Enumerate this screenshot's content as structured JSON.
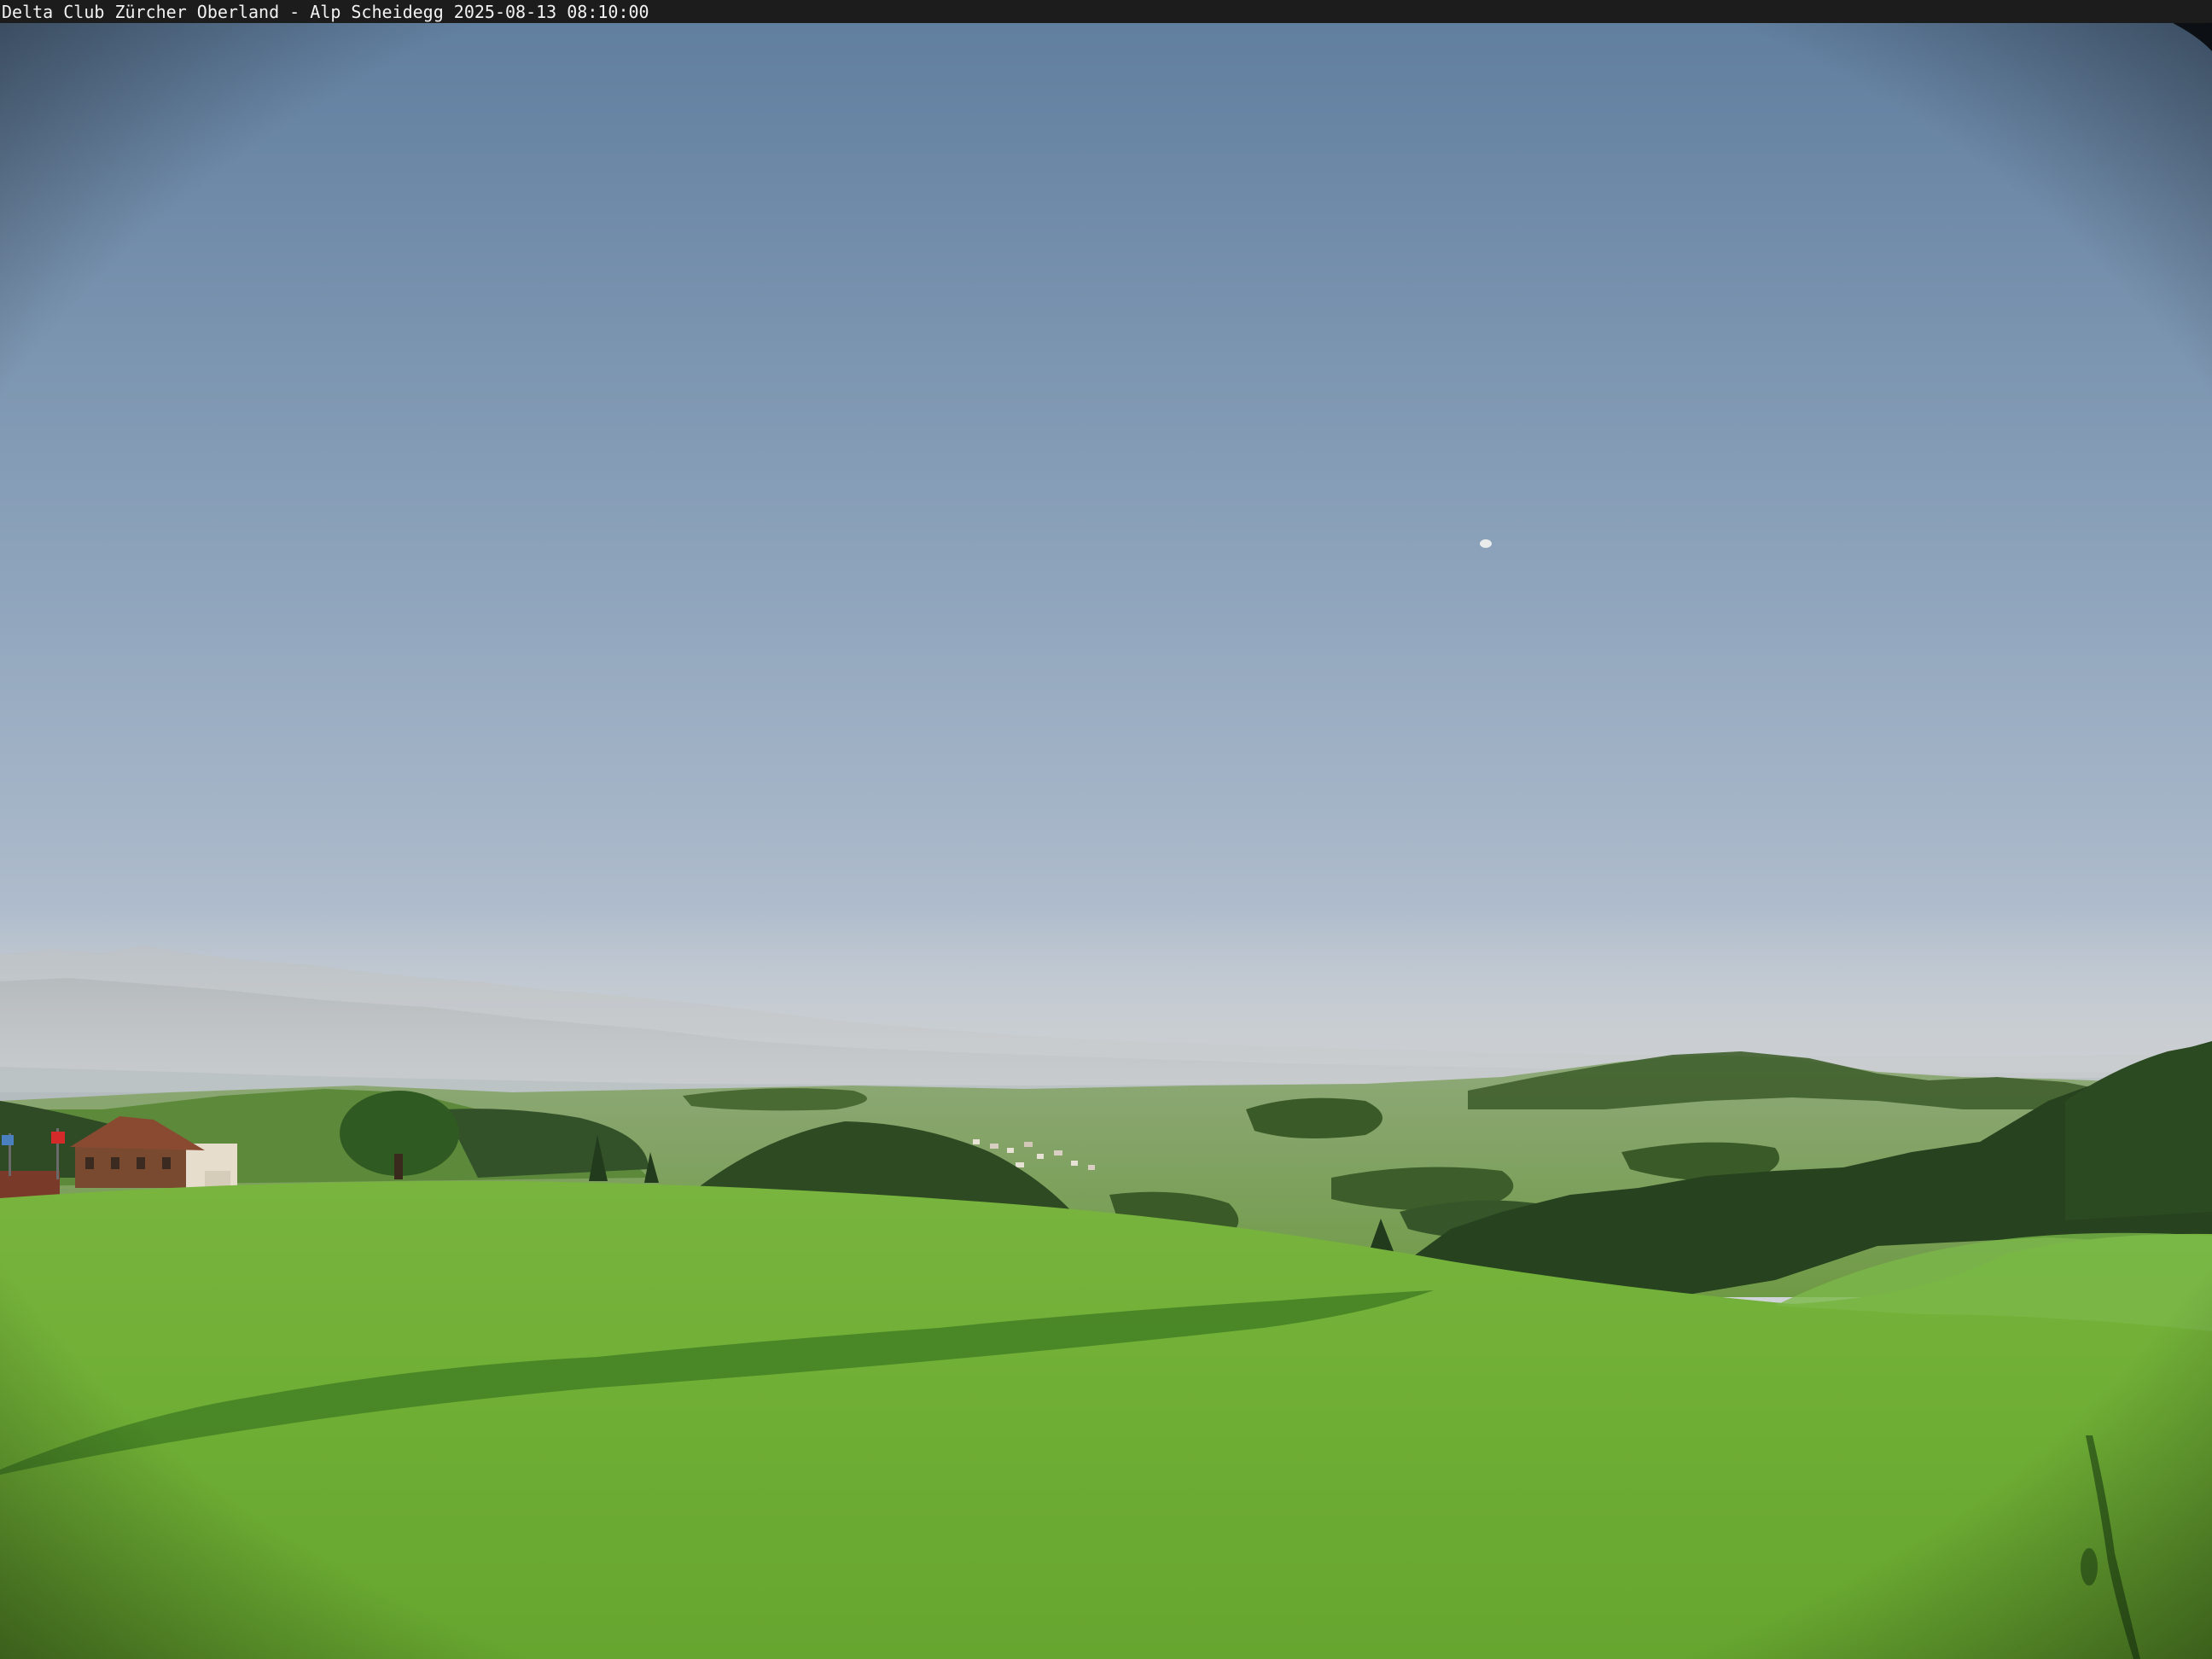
{
  "overlay": {
    "caption": "Delta Club Zürcher Oberland - Alp Scheidegg 2025-08-13 08:10:00"
  },
  "scene": {
    "colors": {
      "sky_top": "#6d88a6",
      "sky_mid": "#aab8c8",
      "sky_horizon": "#e6e2dc",
      "haze": "#c9ccd0",
      "distant_mountains": "#9ea6ac",
      "valley_green": "#7aa34c",
      "forest_dark": "#2e4a22",
      "meadow": "#71b23a",
      "meadow_light": "#86c247",
      "shadow": "#2f5a1c",
      "house_roof": "#8a4a32",
      "house_wall": "#e8e0d2",
      "vignette": "#000000"
    },
    "icons": [
      "moon-icon",
      "swiss-flag-icon",
      "flag-icon"
    ]
  }
}
